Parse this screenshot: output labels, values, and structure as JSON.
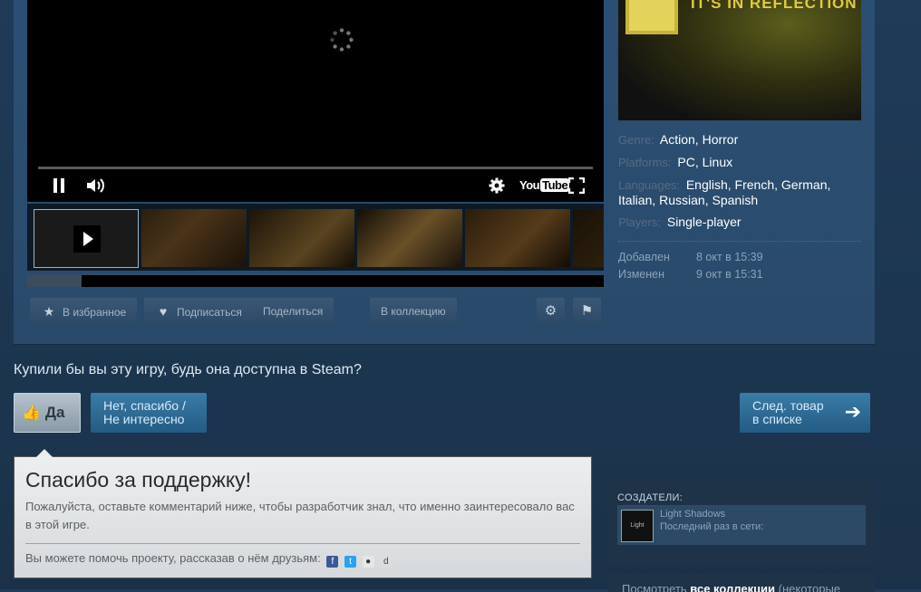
{
  "capsule": {
    "title_text": "IT'S IN REFLECTION"
  },
  "details": {
    "genre": {
      "label": "Genre:",
      "values": [
        "Action",
        "Horror"
      ]
    },
    "platforms": {
      "label": "Platforms:",
      "values": [
        "PC",
        "Linux"
      ]
    },
    "languages": {
      "label": "Languages:",
      "values": [
        "English",
        "French",
        "German",
        "Italian",
        "Russian",
        "Spanish"
      ]
    },
    "players": {
      "label": "Players:",
      "values": [
        "Single-player"
      ]
    },
    "added": {
      "label": "Добавлен",
      "value": "8 окт в 15:39"
    },
    "updated": {
      "label": "Изменен",
      "value": "9 окт в 15:31"
    }
  },
  "player": {
    "youtube_label_you": "You",
    "youtube_label_tube": "Tube"
  },
  "actions": {
    "favorite": "В избранное",
    "follow": "Подписаться",
    "share": "Поделиться",
    "collection": "В коллекцию"
  },
  "vote": {
    "question": "Купили бы вы эту игру, будь она доступна в Steam?",
    "yes": "Да",
    "no_line1": "Нет, спасибо /",
    "no_line2": "Не интересно",
    "next_line1": "След. товар",
    "next_line2": "в списке"
  },
  "thanks": {
    "title": "Спасибо за поддержку!",
    "body": "Пожалуйста, оставьте комментарий ниже, чтобы разработчик знал, что именно заинтересовало вас в этой игре.",
    "share_text": "Вы можете помочь проекту, рассказав о нём друзьям:"
  },
  "creators": {
    "title": "СОЗДАТЕЛИ:",
    "name": "Light Shadows",
    "status": "Последний раз в сети:",
    "avatar_text": "Light Shado"
  },
  "collections": {
    "prefix": "Посмотреть",
    "link": "все коллекции",
    "suffix": "(некоторые"
  },
  "colors": {
    "accent_blue": "#235b83",
    "link_white": "#ffffff",
    "label_gray": "#556b83"
  }
}
